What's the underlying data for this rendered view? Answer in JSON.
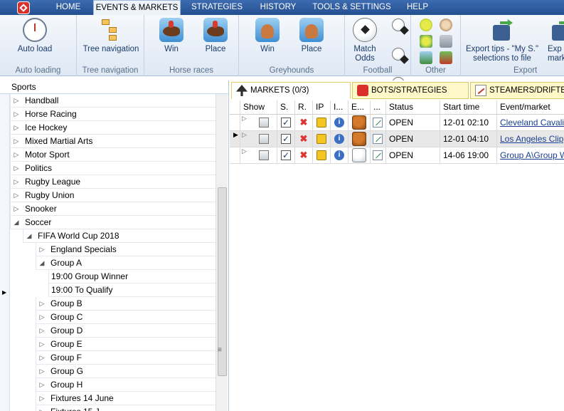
{
  "menu": {
    "tabs": [
      "HOME",
      "EVENTS & MARKETS",
      "STRATEGIES",
      "HISTORY",
      "TOOLS & SETTINGS",
      "HELP"
    ],
    "active": "EVENTS & MARKETS"
  },
  "ribbon": {
    "groups": {
      "auto_loading": {
        "label": "Auto loading",
        "button": "Auto load"
      },
      "tree_navigation": {
        "label": "Tree navigation",
        "button": "Tree navigation"
      },
      "horse_races": {
        "label": "Horse races",
        "win": "Win",
        "place": "Place"
      },
      "greyhounds": {
        "label": "Greyhounds",
        "win": "Win",
        "place": "Place"
      },
      "football": {
        "label": "Football",
        "button_line1": "Match",
        "button_line2": "Odds"
      },
      "other": {
        "label": "Other"
      },
      "export": {
        "label": "Export",
        "button_line1": "Export tips - \"My S.\"",
        "button_line2": "selections to file",
        "cut_line1": "Exp",
        "cut_line2": "mark"
      }
    }
  },
  "tree": {
    "header": "Sports",
    "items": [
      {
        "label": "Handball",
        "expander": "▷"
      },
      {
        "label": "Horse Racing",
        "expander": "▷"
      },
      {
        "label": "Ice Hockey",
        "expander": "▷"
      },
      {
        "label": "Mixed Martial Arts",
        "expander": "▷"
      },
      {
        "label": "Motor Sport",
        "expander": "▷"
      },
      {
        "label": "Politics",
        "expander": "▷"
      },
      {
        "label": "Rugby League",
        "expander": "▷"
      },
      {
        "label": "Rugby Union",
        "expander": "▷"
      },
      {
        "label": "Snooker",
        "expander": "▷"
      },
      {
        "label": "Soccer",
        "expander": "◢"
      },
      {
        "label": "FIFA World Cup 2018",
        "expander": "◢"
      },
      {
        "label": "England Specials",
        "expander": "▷"
      },
      {
        "label": "Group A",
        "expander": "◢"
      },
      {
        "label": "19:00 Group Winner",
        "expander": ""
      },
      {
        "label": "19:00 To Qualify",
        "expander": ""
      },
      {
        "label": "Group B",
        "expander": "▷"
      },
      {
        "label": "Group C",
        "expander": "▷"
      },
      {
        "label": "Group D",
        "expander": "▷"
      },
      {
        "label": "Group E",
        "expander": "▷"
      },
      {
        "label": "Group F",
        "expander": "▷"
      },
      {
        "label": "Group G",
        "expander": "▷"
      },
      {
        "label": "Group H",
        "expander": "▷"
      },
      {
        "label": "Fixtures 14 June",
        "expander": "▷"
      },
      {
        "label": "Fixtures 15 J",
        "expander": "▷"
      }
    ]
  },
  "right_tabs": {
    "markets": "MARKETS (0/3)",
    "bots": "BOTS/STRATEGIES",
    "steamers": "STEAMERS/DRIFTERS"
  },
  "grid": {
    "headers": [
      "Show",
      "S.",
      "R.",
      "IP",
      "I...",
      "E...",
      "...",
      "Status",
      "Start time",
      "Event/market"
    ],
    "rows": [
      {
        "status": "OPEN",
        "start": "12-01 02:10",
        "event": "Cleveland Cavaliers",
        "event_icon": "basketball-icon"
      },
      {
        "status": "OPEN",
        "start": "12-01 04:10",
        "event": "Los Angeles Clippers",
        "event_icon": "basketball-icon"
      },
      {
        "status": "OPEN",
        "start": "14-06 19:00",
        "event": "Group A\\Group Win",
        "event_icon": "football-icon"
      }
    ]
  }
}
